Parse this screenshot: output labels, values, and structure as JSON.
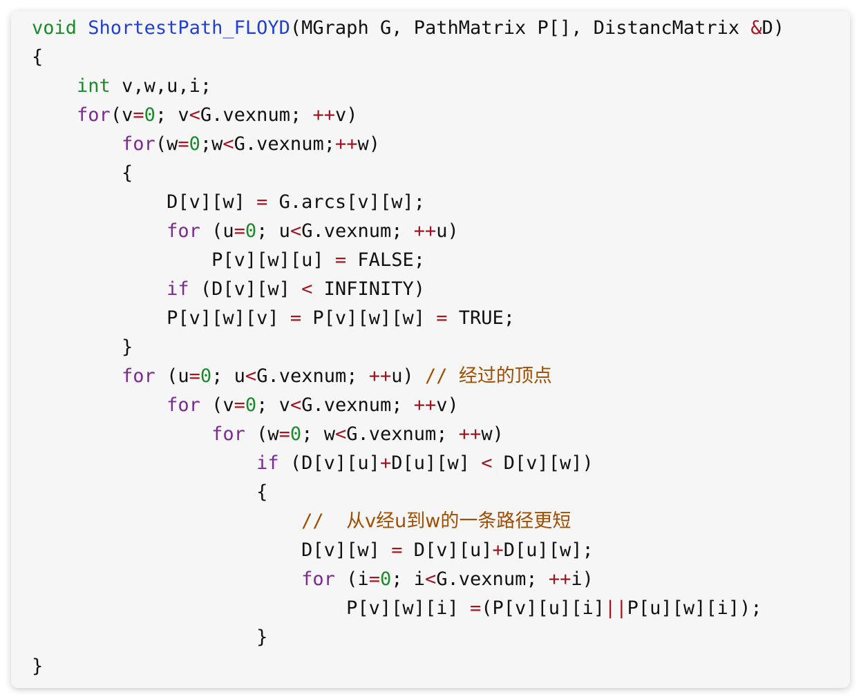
{
  "code_lines": [
    {
      "indent": 0,
      "tokens": [
        [
          "type",
          "void"
        ],
        [
          "",
          "␣"
        ],
        [
          "fn",
          "ShortestPath_FLOYD"
        ],
        [
          "",
          "(MGraph G, PathMatrix P[], DistancMatrix "
        ],
        [
          "op",
          "&"
        ],
        [
          "",
          "D)"
        ]
      ]
    },
    {
      "indent": 0,
      "tokens": [
        [
          "",
          "{"
        ]
      ]
    },
    {
      "indent": 1,
      "tokens": [
        [
          "type",
          "int"
        ],
        [
          "",
          " v,w,u,i;"
        ]
      ]
    },
    {
      "indent": 1,
      "tokens": [
        [
          "kw",
          "for"
        ],
        [
          "",
          "(v"
        ],
        [
          "op",
          "="
        ],
        [
          "num",
          "0"
        ],
        [
          "",
          "; v"
        ],
        [
          "op",
          "<"
        ],
        [
          "",
          "G.vexnum; "
        ],
        [
          "op",
          "++"
        ],
        [
          "",
          "v)"
        ]
      ]
    },
    {
      "indent": 2,
      "tokens": [
        [
          "kw",
          "for"
        ],
        [
          "",
          "(w"
        ],
        [
          "op",
          "="
        ],
        [
          "num",
          "0"
        ],
        [
          "",
          ";w"
        ],
        [
          "op",
          "<"
        ],
        [
          "",
          "G.vexnum;"
        ],
        [
          "op",
          "++"
        ],
        [
          "",
          "w)"
        ]
      ]
    },
    {
      "indent": 2,
      "tokens": [
        [
          "",
          "{"
        ]
      ]
    },
    {
      "indent": 3,
      "tokens": [
        [
          "",
          "D[v][w] "
        ],
        [
          "op",
          "="
        ],
        [
          "",
          " G.arcs[v][w];"
        ]
      ]
    },
    {
      "indent": 3,
      "tokens": [
        [
          "kw",
          "for"
        ],
        [
          "",
          " (u"
        ],
        [
          "op",
          "="
        ],
        [
          "num",
          "0"
        ],
        [
          "",
          "; u"
        ],
        [
          "op",
          "<"
        ],
        [
          "",
          "G.vexnum; "
        ],
        [
          "op",
          "++"
        ],
        [
          "",
          "u)"
        ]
      ]
    },
    {
      "indent": 4,
      "tokens": [
        [
          "",
          "P[v][w][u] "
        ],
        [
          "op",
          "="
        ],
        [
          "",
          " FALSE;"
        ]
      ]
    },
    {
      "indent": 3,
      "tokens": [
        [
          "kw",
          "if"
        ],
        [
          "",
          " (D[v][w] "
        ],
        [
          "op",
          "<"
        ],
        [
          "",
          " INFINITY)"
        ]
      ]
    },
    {
      "indent": 3,
      "tokens": [
        [
          "",
          "P[v][w][v] "
        ],
        [
          "op",
          "="
        ],
        [
          "",
          " P[v][w][w] "
        ],
        [
          "op",
          "="
        ],
        [
          "",
          " TRUE;"
        ]
      ]
    },
    {
      "indent": 2,
      "tokens": [
        [
          "",
          "}"
        ]
      ]
    },
    {
      "indent": 2,
      "tokens": [
        [
          "kw",
          "for"
        ],
        [
          "",
          " (u"
        ],
        [
          "op",
          "="
        ],
        [
          "num",
          "0"
        ],
        [
          "",
          "; u"
        ],
        [
          "op",
          "<"
        ],
        [
          "",
          "G.vexnum; "
        ],
        [
          "op",
          "++"
        ],
        [
          "",
          "u) "
        ],
        [
          "cm",
          "// "
        ],
        [
          "cmc",
          "经过的顶点"
        ]
      ]
    },
    {
      "indent": 3,
      "tokens": [
        [
          "kw",
          "for"
        ],
        [
          "",
          " (v"
        ],
        [
          "op",
          "="
        ],
        [
          "num",
          "0"
        ],
        [
          "",
          "; v"
        ],
        [
          "op",
          "<"
        ],
        [
          "",
          "G.vexnum; "
        ],
        [
          "op",
          "++"
        ],
        [
          "",
          "v)"
        ]
      ]
    },
    {
      "indent": 4,
      "tokens": [
        [
          "kw",
          "for"
        ],
        [
          "",
          " (w"
        ],
        [
          "op",
          "="
        ],
        [
          "num",
          "0"
        ],
        [
          "",
          "; w"
        ],
        [
          "op",
          "<"
        ],
        [
          "",
          "G.vexnum; "
        ],
        [
          "op",
          "++"
        ],
        [
          "",
          "w)"
        ]
      ]
    },
    {
      "indent": 5,
      "tokens": [
        [
          "kw",
          "if"
        ],
        [
          "",
          " (D[v][u]"
        ],
        [
          "op",
          "+"
        ],
        [
          "",
          "D[u][w] "
        ],
        [
          "op",
          "<"
        ],
        [
          "",
          " D[v][w])"
        ]
      ]
    },
    {
      "indent": 5,
      "tokens": [
        [
          "",
          "{"
        ]
      ]
    },
    {
      "indent": 6,
      "tokens": [
        [
          "cm",
          "//  "
        ],
        [
          "cmc",
          "从v经u到w的一条路径更短"
        ]
      ]
    },
    {
      "indent": 6,
      "tokens": [
        [
          "",
          "D[v][w] "
        ],
        [
          "op",
          "="
        ],
        [
          "",
          " D[v][u]"
        ],
        [
          "op",
          "+"
        ],
        [
          "",
          "D[u][w];"
        ]
      ]
    },
    {
      "indent": 6,
      "tokens": [
        [
          "kw",
          "for"
        ],
        [
          "",
          " (i"
        ],
        [
          "op",
          "="
        ],
        [
          "num",
          "0"
        ],
        [
          "",
          "; i"
        ],
        [
          "op",
          "<"
        ],
        [
          "",
          "G.vexnum; "
        ],
        [
          "op",
          "++"
        ],
        [
          "",
          "i)"
        ]
      ]
    },
    {
      "indent": 7,
      "tokens": [
        [
          "",
          "P[v][w][i] "
        ],
        [
          "op",
          "="
        ],
        [
          "",
          "(P[v][u][i]"
        ],
        [
          "op",
          "||"
        ],
        [
          "",
          "P[u][w][i]);"
        ]
      ]
    },
    {
      "indent": 5,
      "tokens": [
        [
          "",
          "}"
        ]
      ]
    },
    {
      "indent": 0,
      "tokens": [
        [
          "",
          "}"
        ]
      ]
    }
  ]
}
